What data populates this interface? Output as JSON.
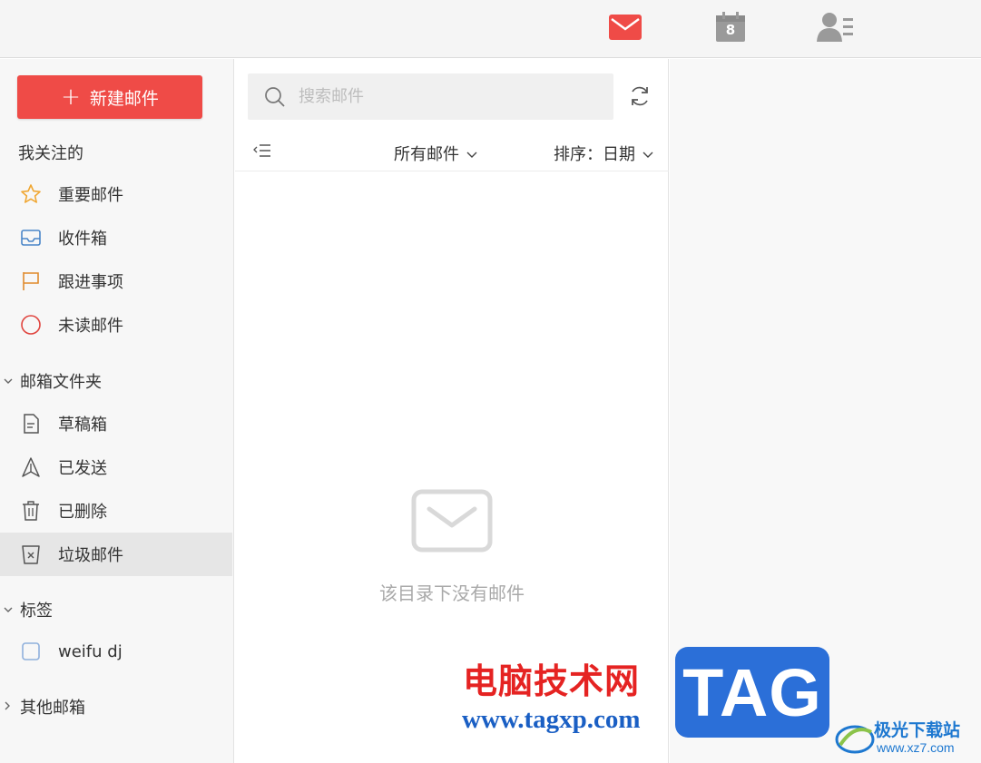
{
  "topbar": {
    "icons": [
      "mail-icon",
      "calendar-icon",
      "contacts-icon"
    ],
    "calendar_day": "8",
    "mail_color": "#ef4b47",
    "icon_gray": "#9a9a9a"
  },
  "sidebar": {
    "compose_label": "新建邮件",
    "favorites_title": "我关注的",
    "favorites": [
      {
        "label": "重要邮件",
        "icon": "star-icon"
      },
      {
        "label": "收件箱",
        "icon": "inbox-icon"
      },
      {
        "label": "跟进事项",
        "icon": "flag-icon"
      },
      {
        "label": "未读邮件",
        "icon": "unread-circle-icon"
      }
    ],
    "folders_title": "邮箱文件夹",
    "folders": [
      {
        "label": "草稿箱",
        "icon": "draft-icon"
      },
      {
        "label": "已发送",
        "icon": "sent-icon"
      },
      {
        "label": "已删除",
        "icon": "trash-icon"
      },
      {
        "label": "垃圾邮件",
        "icon": "spam-icon",
        "selected": true
      }
    ],
    "tags_title": "标签",
    "tags": [
      {
        "label": "weifu dj",
        "icon": "tag-checkbox-icon"
      }
    ],
    "other_title": "其他邮箱"
  },
  "list": {
    "search_placeholder": "搜索邮件",
    "filter_label": "所有邮件",
    "sort_label": "排序：日期",
    "empty_text": "该目录下没有邮件"
  },
  "colors": {
    "accent": "#ef4b47",
    "star": "#f0a732",
    "inbox": "#4a86c8",
    "flag": "#e08a2c",
    "unread": "#e0453f",
    "selected_bg": "#e6e6e6"
  },
  "watermark": {
    "site_name": "电脑技术网",
    "site_url": "www.tagxp.com",
    "tag_text": "TAG",
    "logo_text": "极光下载站",
    "logo_url": "www.xz7.com"
  }
}
